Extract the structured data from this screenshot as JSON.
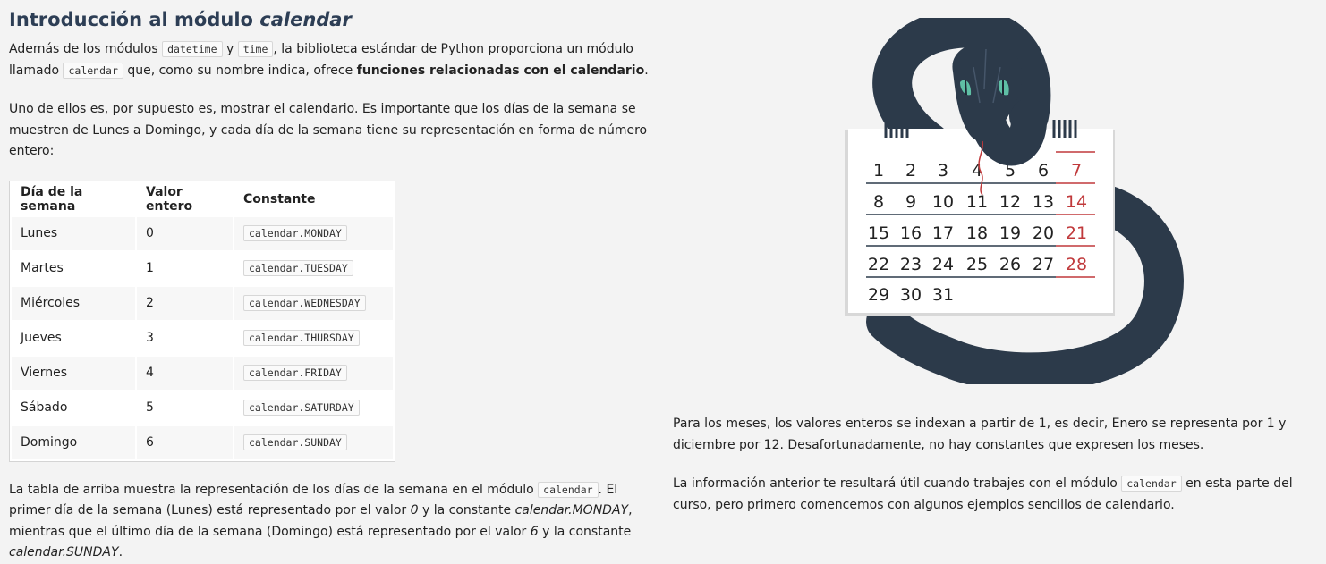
{
  "heading": {
    "text": "Introducción al módulo ",
    "em": "calendar"
  },
  "intro": {
    "t1": "Además de los módulos ",
    "code1": "datetime",
    "t2": " y ",
    "code2": "time",
    "t3": ", la biblioteca estándar de Python proporciona un módulo llamado ",
    "code3": "calendar",
    "t4": " que, como su nombre indica, ofrece ",
    "bold": "funciones relacionadas con el calendario",
    "t5": "."
  },
  "para2": "Uno de ellos es, por supuesto es, mostrar el calendario. Es importante que los días de la semana se muestren de Lunes a Domingo, y cada día de la semana tiene su representación en forma de número entero:",
  "table": {
    "headers": [
      "Día de la semana",
      "Valor entero",
      "Constante"
    ],
    "rows": [
      [
        "Lunes",
        "0",
        "calendar.MONDAY"
      ],
      [
        "Martes",
        "1",
        "calendar.TUESDAY"
      ],
      [
        "Miércoles",
        "2",
        "calendar.WEDNESDAY"
      ],
      [
        "Jueves",
        "3",
        "calendar.THURSDAY"
      ],
      [
        "Viernes",
        "4",
        "calendar.FRIDAY"
      ],
      [
        "Sábado",
        "5",
        "calendar.SATURDAY"
      ],
      [
        "Domingo",
        "6",
        "calendar.SUNDAY"
      ]
    ]
  },
  "para3": {
    "t1": "La tabla de arriba muestra la representación de los días de la semana en el módulo ",
    "code1": "calendar",
    "t2": ". El primer día de la semana (Lunes) está representado por el valor ",
    "em1": "0",
    "t3": " y la constante ",
    "em2": "calendar.MONDAY",
    "t4": ", mientras que el último día de la semana (Domingo) está representado por el valor ",
    "em3": "6",
    "t5": " y la constante ",
    "em4": "calendar.SUNDAY",
    "t6": "."
  },
  "para4": "Para los meses, los valores enteros se indexan a partir de 1, es decir, Enero se representa por 1 y diciembre por 12. Desafortunadamente, no hay constantes que expresen los meses.",
  "para5": {
    "t1": "La información anterior te resultará útil cuando trabajes con el módulo ",
    "code1": "calendar",
    "t2": " en esta parte del curso, pero primero comencemos con algunos ejemplos sencillos de calendario."
  },
  "illustration": {
    "icon": "snake-calendar-illustration",
    "rows": [
      [
        "1",
        "2",
        "3",
        "4",
        "5",
        "6",
        "7"
      ],
      [
        "8",
        "9",
        "10",
        "11",
        "12",
        "13",
        "14"
      ],
      [
        "15",
        "16",
        "17",
        "18",
        "19",
        "20",
        "21"
      ],
      [
        "22",
        "23",
        "24",
        "25",
        "26",
        "27",
        "28"
      ],
      [
        "29",
        "30",
        "31"
      ]
    ],
    "colors": {
      "snake": "#2c3a4a",
      "sunday": "#c0393b",
      "text": "#222222",
      "paper": "#ffffff",
      "eye": "#5fbfa5"
    }
  }
}
